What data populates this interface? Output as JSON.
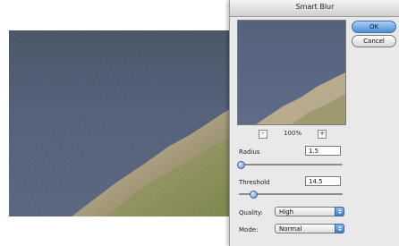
{
  "dialog": {
    "title": "Smart Blur",
    "ok_label": "OK",
    "cancel_label": "Cancel",
    "zoom": {
      "minus": "-",
      "value": "100%",
      "plus": "+"
    },
    "radius": {
      "label": "Radius",
      "value": "1.5",
      "level_fraction": 0.02
    },
    "threshold": {
      "label": "Threshold",
      "value": "14.5",
      "level_fraction": 0.14
    },
    "quality": {
      "label": "Quality:",
      "value": "High"
    },
    "mode": {
      "label": "Mode:",
      "value": "Normal"
    }
  },
  "colors": {
    "sky": "#55617a",
    "mountain": "#b6a98c",
    "ok_accent": "#4d8fd6"
  }
}
